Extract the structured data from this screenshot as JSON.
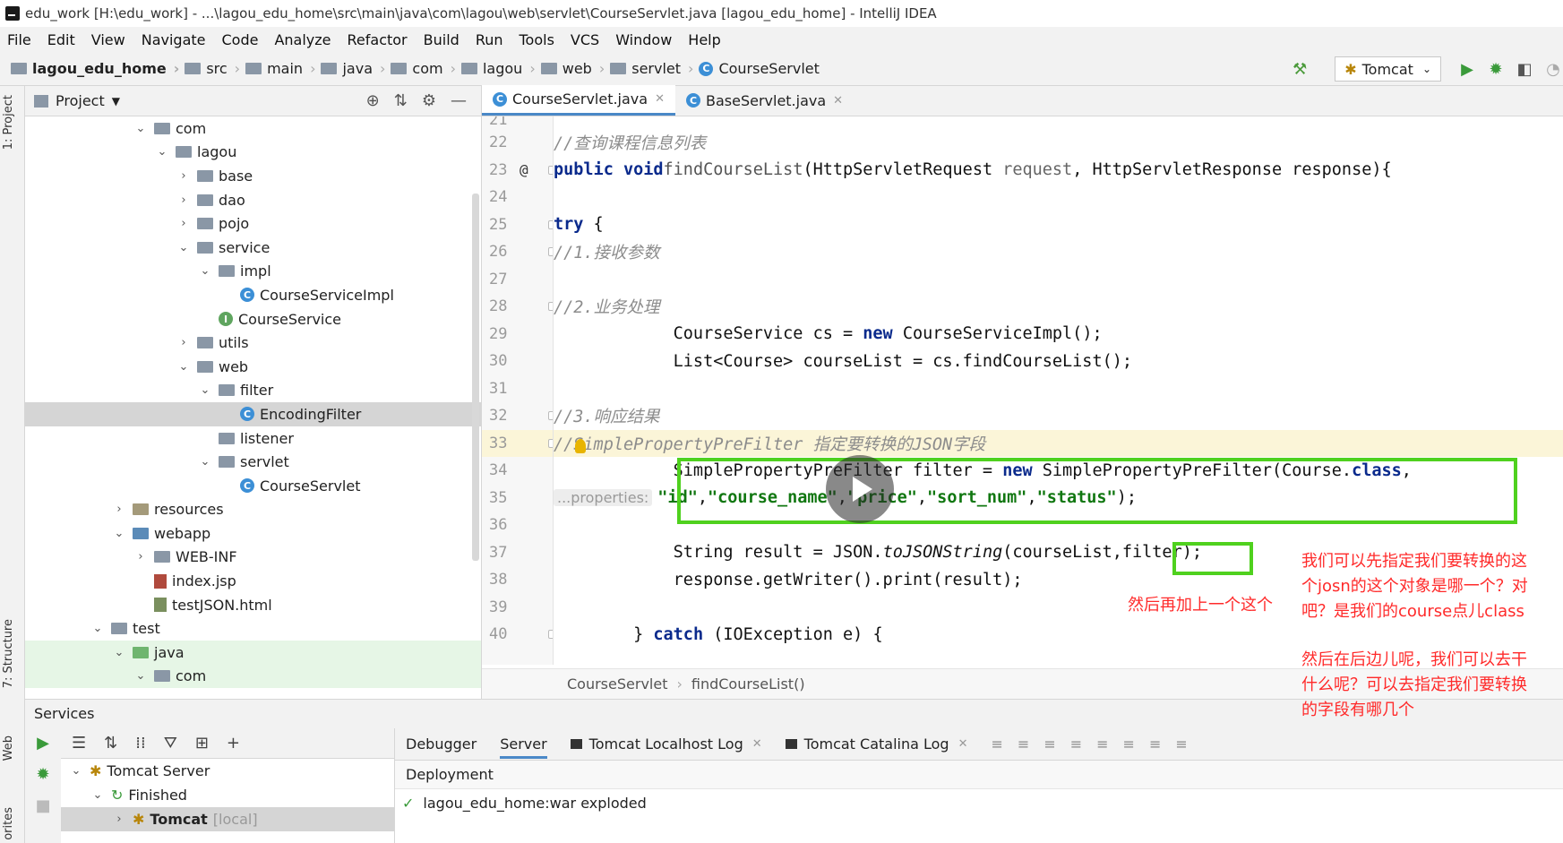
{
  "window": {
    "title": "edu_work [H:\\edu_work] - ...\\lagou_edu_home\\src\\main\\java\\com\\lagou\\web\\servlet\\CourseServlet.java [lagou_edu_home] - IntelliJ IDEA"
  },
  "menu": [
    "File",
    "Edit",
    "View",
    "Navigate",
    "Code",
    "Analyze",
    "Refactor",
    "Build",
    "Run",
    "Tools",
    "VCS",
    "Window",
    "Help"
  ],
  "breadcrumb": [
    "lagou_edu_home",
    "src",
    "main",
    "java",
    "com",
    "lagou",
    "web",
    "servlet",
    "CourseServlet"
  ],
  "run_config": "Tomcat",
  "left_strip": {
    "project_tab": "1: Project",
    "structure_tab": "7: Structure",
    "web_tab": "Web",
    "favorites_tab": "orites"
  },
  "project": {
    "title": "Project",
    "tree": [
      {
        "label": "com",
        "indent": 1,
        "chev": "v",
        "kind": "folder"
      },
      {
        "label": "lagou",
        "indent": 2,
        "chev": "v",
        "kind": "folder"
      },
      {
        "label": "base",
        "indent": 3,
        "chev": ">",
        "kind": "folder"
      },
      {
        "label": "dao",
        "indent": 3,
        "chev": ">",
        "kind": "folder"
      },
      {
        "label": "pojo",
        "indent": 3,
        "chev": ">",
        "kind": "folder"
      },
      {
        "label": "service",
        "indent": 3,
        "chev": "v",
        "kind": "folder"
      },
      {
        "label": "impl",
        "indent": 4,
        "chev": "v",
        "kind": "folder"
      },
      {
        "label": "CourseServiceImpl",
        "indent": 5,
        "chev": "",
        "kind": "class"
      },
      {
        "label": "CourseService",
        "indent": 4,
        "chev": "",
        "kind": "interface"
      },
      {
        "label": "utils",
        "indent": 3,
        "chev": ">",
        "kind": "folder"
      },
      {
        "label": "web",
        "indent": 3,
        "chev": "v",
        "kind": "folder"
      },
      {
        "label": "filter",
        "indent": 4,
        "chev": "v",
        "kind": "folder"
      },
      {
        "label": "EncodingFilter",
        "indent": 5,
        "chev": "",
        "kind": "class",
        "selected": true
      },
      {
        "label": "listener",
        "indent": 4,
        "chev": "",
        "kind": "folder"
      },
      {
        "label": "servlet",
        "indent": 4,
        "chev": "v",
        "kind": "folder"
      },
      {
        "label": "CourseServlet",
        "indent": 5,
        "chev": "",
        "kind": "class"
      },
      {
        "label": "resources",
        "indent": 0,
        "chev": ">",
        "kind": "res"
      },
      {
        "label": "webapp",
        "indent": 0,
        "chev": "v",
        "kind": "web"
      },
      {
        "label": "WEB-INF",
        "indent": 1,
        "chev": ">",
        "kind": "folder"
      },
      {
        "label": "index.jsp",
        "indent": 1,
        "chev": "",
        "kind": "jsp"
      },
      {
        "label": "testJSON.html",
        "indent": 1,
        "chev": "",
        "kind": "html"
      },
      {
        "label": "test",
        "indent": -1,
        "chev": "v",
        "kind": "folder"
      },
      {
        "label": "java",
        "indent": 0,
        "chev": "v",
        "kind": "green",
        "green": true
      },
      {
        "label": "com",
        "indent": 1,
        "chev": "v",
        "kind": "folder",
        "green": true
      }
    ]
  },
  "editor": {
    "tabs": [
      {
        "label": "CourseServlet.java",
        "active": true
      },
      {
        "label": "BaseServlet.java",
        "active": false
      }
    ],
    "first_line_number_partial": "21",
    "lines": [
      {
        "n": "22",
        "html": "    <span class='cm'>//查询课程信息列表</span>"
      },
      {
        "n": "23",
        "html": "    <span class='kw'>public void</span> <span class='mth'>findCourseList</span>(HttpServletRequest <span class='prm'>request</span>, HttpServletResponse response){",
        "at": true
      },
      {
        "n": "24",
        "html": ""
      },
      {
        "n": "25",
        "html": "        <span class='kw'>try</span> {"
      },
      {
        "n": "26",
        "html": "            <span class='cm'>//1.接收参数</span>"
      },
      {
        "n": "27",
        "html": ""
      },
      {
        "n": "28",
        "html": "            <span class='cm'>//2.业务处理</span>"
      },
      {
        "n": "29",
        "html": "            CourseService cs = <span class='kw'>new</span> CourseServiceImpl();"
      },
      {
        "n": "30",
        "html": "            List&lt;Course&gt; courseList = cs.findCourseList();"
      },
      {
        "n": "31",
        "html": ""
      },
      {
        "n": "32",
        "html": "            <span class='cm'>//3.响应结果</span>"
      },
      {
        "n": "33",
        "html": "            <span class='cm'>//SimplePropertyPreFilter 指定要转换的JSON字段</span>",
        "current": true
      },
      {
        "n": "34",
        "html": "            SimplePropertyPreFilter filter = <span class='kw'>new</span> SimplePropertyPreFilter(Course.<span class='kw'>class</span>,"
      },
      {
        "n": "35",
        "html": "                    <span class='hint'>...properties:</span><span class='str'>\"id\"</span>,<span class='str'>\"course_name\"</span>,<span class='str'>\"price\"</span>,<span class='str'>\"sort_num\"</span>,<span class='str'>\"status\"</span>);"
      },
      {
        "n": "36",
        "html": ""
      },
      {
        "n": "37",
        "html": "            String result = JSON.<span class='it'>toJSONString</span>(courseList,filter);"
      },
      {
        "n": "38",
        "html": "            response.getWriter().print(result);"
      },
      {
        "n": "39",
        "html": ""
      },
      {
        "n": "40",
        "html": "        } <span class='kw'>catch</span> (IOException e) {"
      }
    ],
    "code_breadcrumb": [
      "CourseServlet",
      "findCourseList()"
    ]
  },
  "services": {
    "title": "Services",
    "tree": [
      {
        "label": "Tomcat Server",
        "chev": "v",
        "indent": 0
      },
      {
        "label": "Finished",
        "chev": "v",
        "indent": 1
      },
      {
        "label": "Tomcat",
        "suffix": "[local]",
        "chev": ">",
        "indent": 2,
        "selected": true
      }
    ],
    "tabs": [
      "Debugger",
      "Server",
      "Tomcat Localhost Log",
      "Tomcat Catalina Log"
    ],
    "active_tab": "Server",
    "deployment_header": "Deployment",
    "deployment_item": "lagou_edu_home:war exploded"
  },
  "annotations": {
    "left_note": "然后再加上一个这个",
    "right_note_1": [
      "我们可以先指定我们要转换的这",
      "个josn的这个对象是哪一个？对",
      "吧？是我们的course点儿class"
    ],
    "right_note_2": [
      "然后在后边儿呢，我们可以去干",
      "什么呢？可以去指定我们要转换",
      "的字段有哪几个"
    ]
  },
  "colors": {
    "accent": "#4a88c7",
    "highlight_box": "#4fd11e",
    "annotation": "#ff2a2a"
  }
}
